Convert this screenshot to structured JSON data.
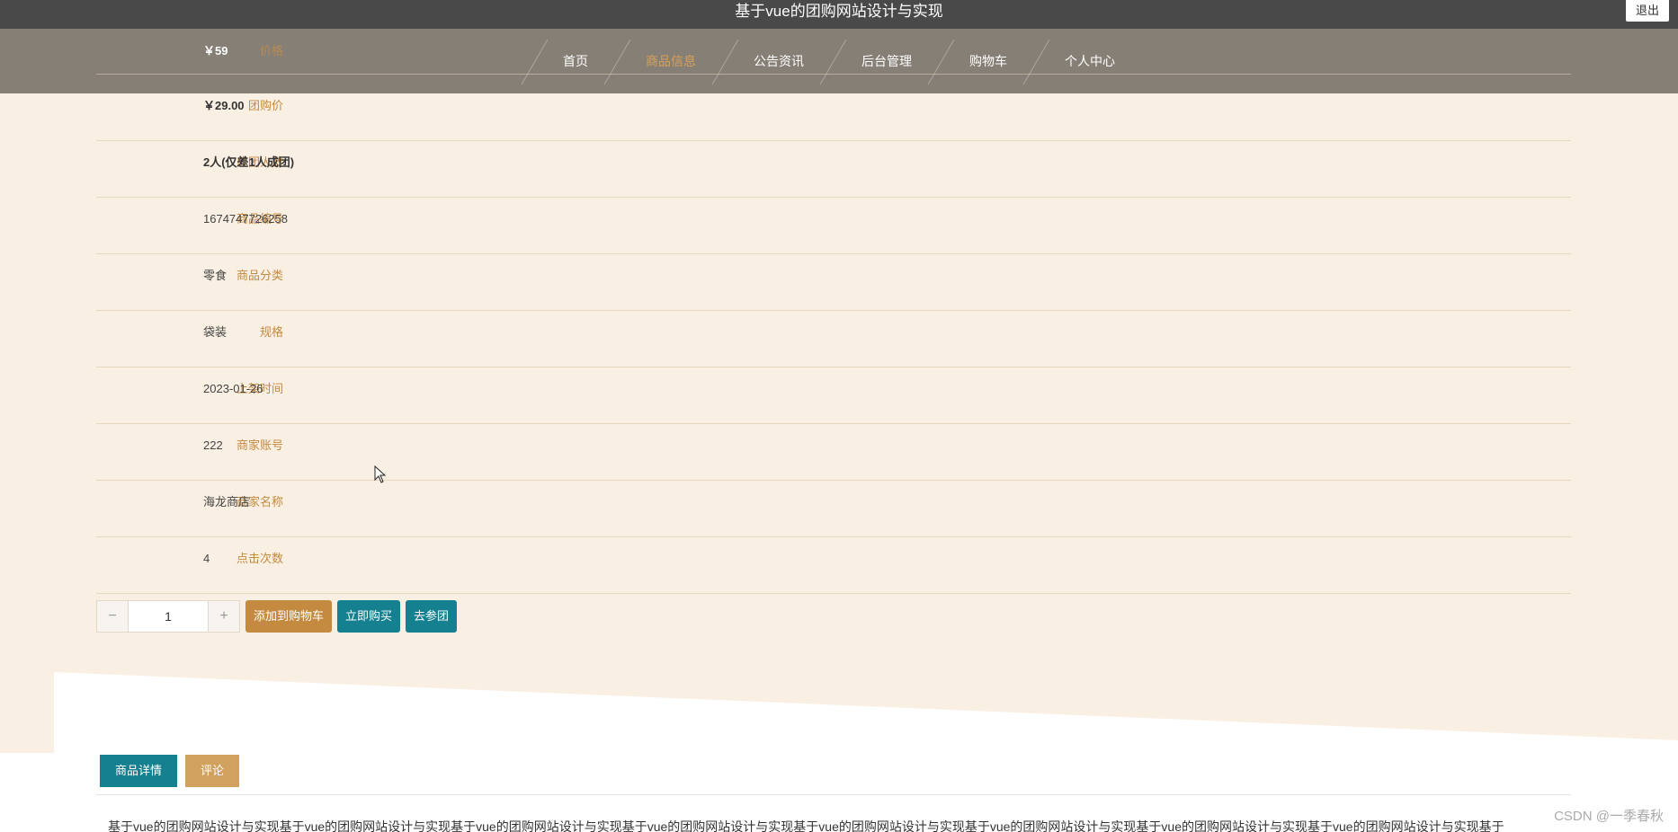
{
  "app": {
    "title": "基于vue的团购网站设计与实现",
    "logout_label": "退出"
  },
  "nav": {
    "items": [
      "首页",
      "商品信息",
      "公告资讯",
      "后台管理",
      "购物车",
      "个人中心"
    ],
    "active": "商品信息"
  },
  "price_row": {
    "label": "价格",
    "value": "￥59"
  },
  "details": [
    {
      "label": "团购价",
      "value": "￥29.00",
      "bold": true
    },
    {
      "label": "成团人数",
      "value": "2人(仅差1人成团)",
      "bold": true
    },
    {
      "label": "商品编号",
      "value": "1674747726258"
    },
    {
      "label": "商品分类",
      "value": "零食"
    },
    {
      "label": "规格",
      "value": "袋装"
    },
    {
      "label": "上架时间",
      "value": "2023-01-26"
    },
    {
      "label": "商家账号",
      "value": "222"
    },
    {
      "label": "商家名称",
      "value": "海龙商店"
    },
    {
      "label": "点击次数",
      "value": "4"
    }
  ],
  "actions": {
    "minus": "−",
    "plus": "+",
    "quantity": "1",
    "add_to_cart": "添加到购物车",
    "buy_now": "立即购买",
    "join_group": "去参团"
  },
  "tabs": [
    {
      "label": "商品详情"
    },
    {
      "label": "评论"
    }
  ],
  "description": "基于vue的团购网站设计与实现基于vue的团购网站设计与实现基于vue的团购网站设计与实现基于vue的团购网站设计与实现基于vue的团购网站设计与实现基于vue的团购网站设计与实现基于vue的团购网站设计与实现基于vue的团购网站设计与实现基于",
  "watermark": "CSDN @一季春秋",
  "colors": {
    "accent": "#c48a3f",
    "teal": "#15808f",
    "page_bg": "#faefe3"
  }
}
